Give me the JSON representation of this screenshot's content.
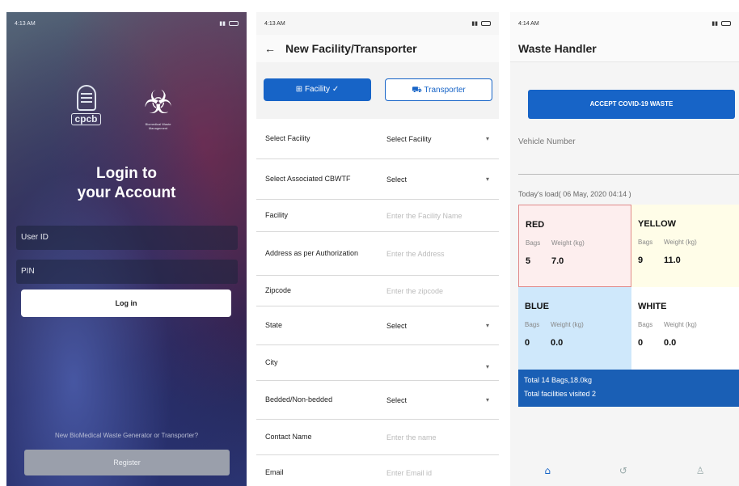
{
  "colors": {
    "primary": "#1764c7",
    "red_cell": "#fdeeee",
    "yellow_cell": "#fffde8",
    "blue_cell": "#cfe8fb",
    "totals_bar": "#1a5fb5"
  },
  "login": {
    "status_time": "4:13 AM",
    "logo_text": "cpcb",
    "biohazard_caption": "Biomedical Waste Management",
    "title_line1": "Login to",
    "title_line2": "your Account",
    "userid_placeholder": "User ID",
    "pin_placeholder": "PIN",
    "login_button": "Log in",
    "register_prompt": "New BioMedical Waste Generator or Transporter?",
    "register_button": "Register"
  },
  "facility": {
    "status_time": "4:13 AM",
    "back_icon": "arrow-left-icon",
    "title": "New Facility/Transporter",
    "facility_tab": "Facility ✓",
    "transporter_tab": "Transporter",
    "rows": [
      {
        "label": "Select Facility",
        "value": "Select Facility",
        "dropdown": true
      },
      {
        "label": "Select Associated CBWTF",
        "value": "Select",
        "dropdown": true
      },
      {
        "label": "Facility",
        "value": "Enter the Facility Name",
        "dropdown": false
      },
      {
        "label": "Address as per Authorization",
        "value": "Enter the Address",
        "dropdown": false
      },
      {
        "label": "Zipcode",
        "value": "Enter the zipcode",
        "dropdown": false
      },
      {
        "label": "State",
        "value": "Select",
        "dropdown": true
      },
      {
        "label": "City",
        "value": "",
        "dropdown": true
      },
      {
        "label": "Bedded/Non-bedded",
        "value": "Select",
        "dropdown": true
      },
      {
        "label": "Contact Name",
        "value": "Enter the name",
        "dropdown": false
      },
      {
        "label": "Email",
        "value": "Enter Email id",
        "dropdown": false
      }
    ]
  },
  "handler": {
    "status_time": "4:14 AM",
    "title": "Waste Handler",
    "accept_button": "ACCEPT COVID-19 WASTE",
    "vehicle_label": "Vehicle Number",
    "today_load": "Today's load( 06 May, 2020 04:14 )",
    "bags_label": "Bags",
    "weight_label": "Weight (kg)",
    "cells": {
      "red": {
        "name": "RED",
        "bags": "5",
        "weight": "7.0"
      },
      "yellow": {
        "name": "YELLOW",
        "bags": "9",
        "weight": "11.0"
      },
      "blue": {
        "name": "BLUE",
        "bags": "0",
        "weight": "0.0"
      },
      "white": {
        "name": "WHITE",
        "bags": "0",
        "weight": "0.0"
      }
    },
    "total_bags": "Total 14 Bags,18.0kg",
    "total_facilities": "Total facilities visited 2",
    "nav": [
      "home-icon",
      "history-icon",
      "profile-icon"
    ]
  }
}
